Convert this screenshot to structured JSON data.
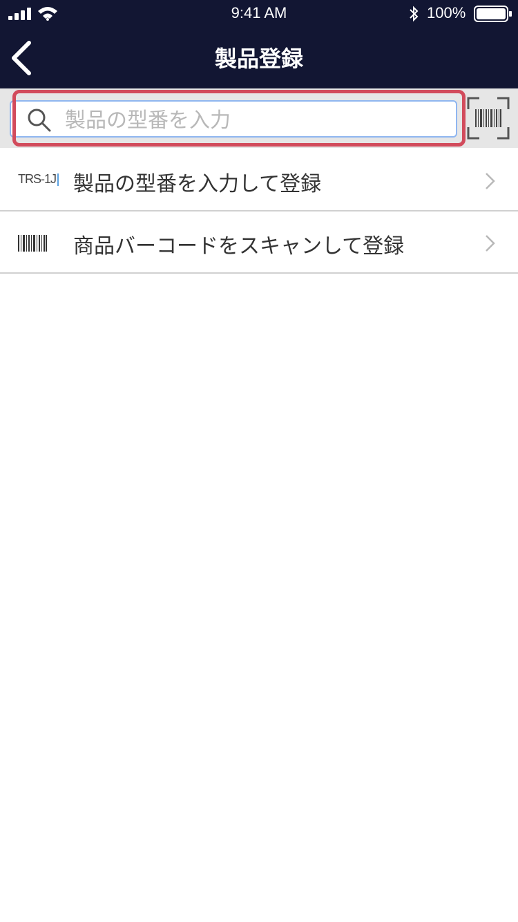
{
  "status_bar": {
    "time": "9:41 AM",
    "battery_percent": "100%"
  },
  "header": {
    "title": "製品登録"
  },
  "search": {
    "placeholder": "製品の型番を入力",
    "value": ""
  },
  "list": {
    "items": [
      {
        "icon_text": "TRS-1J",
        "icon": "model-number-icon",
        "label": "製品の型番を入力して登録"
      },
      {
        "icon": "barcode-icon",
        "label": "商品バーコードをスキャンして登録"
      }
    ]
  },
  "colors": {
    "header_bg": "#121633",
    "highlight": "#d24b5c",
    "search_border": "#8fb6f0",
    "strip_bg": "#e6e6e6"
  }
}
